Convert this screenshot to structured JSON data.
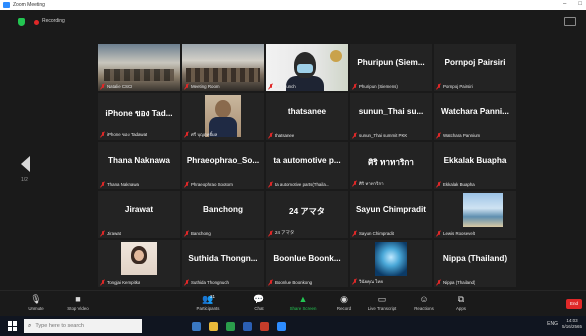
{
  "window": {
    "title": "Zoom Meeting",
    "controls": [
      "–",
      "□"
    ]
  },
  "meeting": {
    "recording_label": "Recording"
  },
  "nav": {
    "page_indicator": "1/2"
  },
  "tiles": [
    {
      "name": "",
      "label": "Natalie CSCI",
      "kind": "video-room",
      "active": true
    },
    {
      "name": "",
      "label": "Meeting Room",
      "kind": "video-room2"
    },
    {
      "name": "",
      "label": "Jack lunch",
      "kind": "video-mask"
    },
    {
      "name": "Phuripun (Siem...",
      "label": "Phuripun (Siemens)",
      "kind": "name"
    },
    {
      "name": "Pornpoj Pairsiri",
      "label": "Pornpoj Pairsiri",
      "kind": "name"
    },
    {
      "name": "iPhone ของ Tad...",
      "label": "iPhone ของ Tadawat",
      "kind": "name"
    },
    {
      "name": "",
      "label": "ศรี บุญฤทธิ์ผล",
      "kind": "photo-man"
    },
    {
      "name": "thatsanee",
      "label": "thatsanee",
      "kind": "name"
    },
    {
      "name": "sunun_Thai su...",
      "label": "sunun_Thai summit PKK",
      "kind": "name"
    },
    {
      "name": "Watchara Panni...",
      "label": "Watchara Pannium",
      "kind": "name"
    },
    {
      "name": "Thana Naknawa",
      "label": "Thana Naknawa",
      "kind": "name"
    },
    {
      "name": "Phraeophrao_So...",
      "label": "Phraeophrao Sootorn",
      "kind": "name"
    },
    {
      "name": "ta automotive p...",
      "label": "ta automotive parts(Thaila...",
      "kind": "name"
    },
    {
      "name": "ศิริ ทาทาริกา",
      "label": "ศิริ ทาทาริกา",
      "kind": "name"
    },
    {
      "name": "Ekkalak Buapha",
      "label": "Ekkalak Buapha",
      "kind": "name"
    },
    {
      "name": "Jirawat",
      "label": "Jirawat",
      "kind": "name"
    },
    {
      "name": "Banchong",
      "label": "Banchong",
      "kind": "name"
    },
    {
      "name": "24 アマタ",
      "label": "24 アマタ",
      "kind": "name"
    },
    {
      "name": "Sayun Chimpradit",
      "label": "Sayun Chimpradit",
      "kind": "name"
    },
    {
      "name": "",
      "label": "Lewis Roosevelt",
      "kind": "photo-sea"
    },
    {
      "name": "",
      "label": "Tongjai Kempitka",
      "kind": "photo-woman"
    },
    {
      "name": "Suthida Thongn...",
      "label": "Suthida Thongnuch",
      "kind": "name"
    },
    {
      "name": "Boonlue Boonk...",
      "label": "Boonlue Boonkong",
      "kind": "name"
    },
    {
      "name": "",
      "label": "วินัยคุณ ไทย",
      "kind": "photo-blue"
    },
    {
      "name": "Nippa (Thailand)",
      "label": "Nippa (Thailand)",
      "kind": "name"
    }
  ],
  "toolbar": {
    "unmute": "Unmute",
    "stop_video": "Stop Video",
    "participants": "Participants",
    "participants_count": "31",
    "chat": "Chat",
    "share_screen": "Share Screen",
    "record": "Record",
    "live_transcript": "Live Transcript",
    "reactions": "Reactions",
    "apps": "Apps",
    "end": "End"
  },
  "taskbar": {
    "search_placeholder": "Type here to search",
    "lang": "ENG",
    "time": "14:03",
    "date": "5/16/2565"
  }
}
